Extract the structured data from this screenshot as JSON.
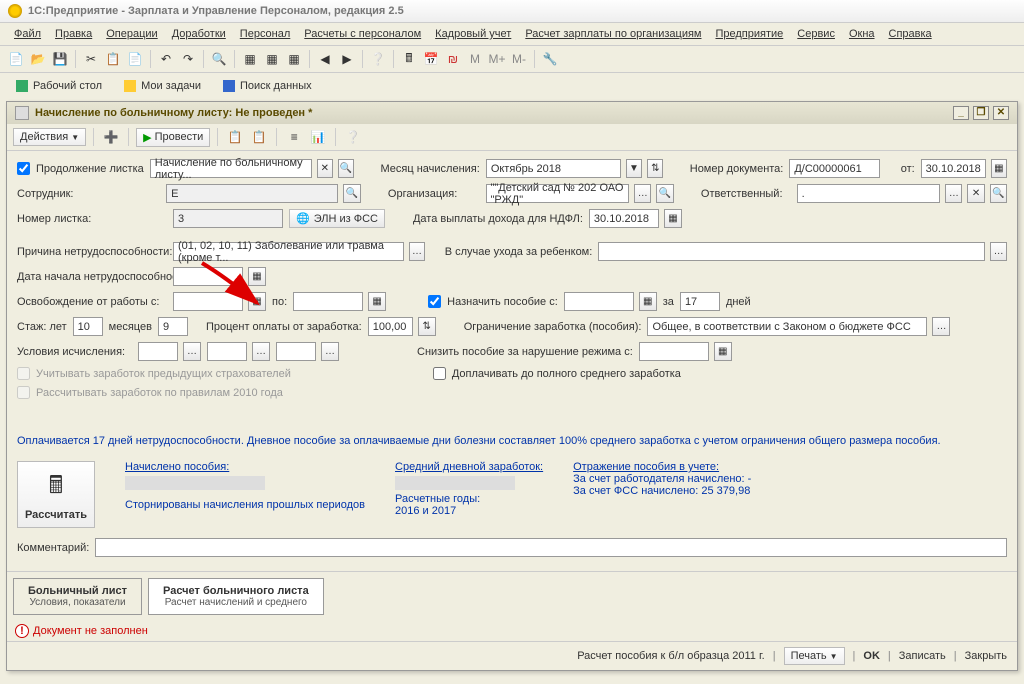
{
  "app": {
    "title": "1С:Предприятие - Зарплата и Управление Персоналом, редакция 2.5"
  },
  "menu": [
    "Файл",
    "Правка",
    "Операции",
    "Доработки",
    "Персонал",
    "Расчеты с персоналом",
    "Кадровый учет",
    "Расчет зарплаты по организациям",
    "Предприятие",
    "Сервис",
    "Окна",
    "Справка"
  ],
  "tabs": [
    "Рабочий стол",
    "Мои задачи",
    "Поиск данных"
  ],
  "win": {
    "title": "Начисление по больничному листу: Не проведен *",
    "actions": "Действия",
    "btn_post": "Провести"
  },
  "form": {
    "cont_label": "Продолжение листка",
    "cont_value": "Начисление по больничному листу...",
    "month_label": "Месяц начисления:",
    "month_value": "Октябрь 2018",
    "docnum_label": "Номер документа:",
    "docnum_value": "Д/С00000061",
    "from_label": "от:",
    "from_value": "30.10.2018",
    "emp_label": "Сотрудник:",
    "emp_value": "Е",
    "org_label": "Организация:",
    "org_value": "\"\"Детский сад № 202 ОАО \"РЖД\"",
    "resp_label": "Ответственный:",
    "resp_value": ".",
    "sheet_label": "Номер листка:",
    "sheet_value": "3",
    "eln_btn": "ЭЛН из ФСС",
    "ndfl_label": "Дата выплаты дохода для НДФЛ:",
    "ndfl_value": "30.10.2018",
    "reason_label": "Причина нетрудоспособности:",
    "reason_value": "(01, 02, 10, 11) Заболевание или травма (кроме т...",
    "child_label": "В случае ухода за ребенком:",
    "start_label": "Дата начала нетрудоспособнос...",
    "release_label": "Освобождение от работы с:",
    "to_label": "по:",
    "assign_label": "Назначить пособие с:",
    "for_label": "за",
    "days_value": "17",
    "days_label": "дней",
    "stazh_label": "Стаж: лет",
    "stazh_years": "10",
    "stazh_mon_label": "месяцев",
    "stazh_months": "9",
    "percent_label": "Процент оплаты от заработка:",
    "percent_value": "100,00",
    "limit_label": "Ограничение заработка (пособия):",
    "limit_value": "Общее, в соответствии с Законом о бюджете ФСС",
    "cond_label": "Условия исчисления:",
    "reduce_label": "Снизить пособие за нарушение режима с:",
    "prev_ins_label": "Учитывать заработок предыдущих страхователей",
    "pay_full_label": "Доплачивать до полного среднего заработка",
    "rules2010_label": "Рассчитывать заработок по правилам 2010 года",
    "info_text": "Оплачивается 17 дней нетрудоспособности. Дневное пособие за оплачиваемые дни болезни составляет 100% среднего заработка с учетом ограничения общего размера пособия.",
    "calc_btn": "Рассчитать",
    "accrued_label": "Начислено пособия:",
    "storno_text": "Сторнированы начисления прошлых периодов",
    "avg_label": "Средний дневной заработок:",
    "calc_years_label": "Расчетные годы:",
    "calc_years_value": "2016 и 2017",
    "refl_label": "Отражение пособия в учете:",
    "refl_emp": "За счет работодателя начислено: -",
    "refl_fss": "За счет ФСС начислено: 25 379,98",
    "comment_label": "Комментарий:",
    "tab1_title": "Больничный лист",
    "tab1_sub": "Условия, показатели",
    "tab2_title": "Расчет больничного листа",
    "tab2_sub": "Расчет начислений и среднего",
    "warn": "Документ не заполнен",
    "bottom_info": "Расчет пособия к б/л образца 2011 г.",
    "btn_print": "Печать",
    "btn_ok": "OK",
    "btn_save": "Записать",
    "btn_close": "Закрыть"
  }
}
